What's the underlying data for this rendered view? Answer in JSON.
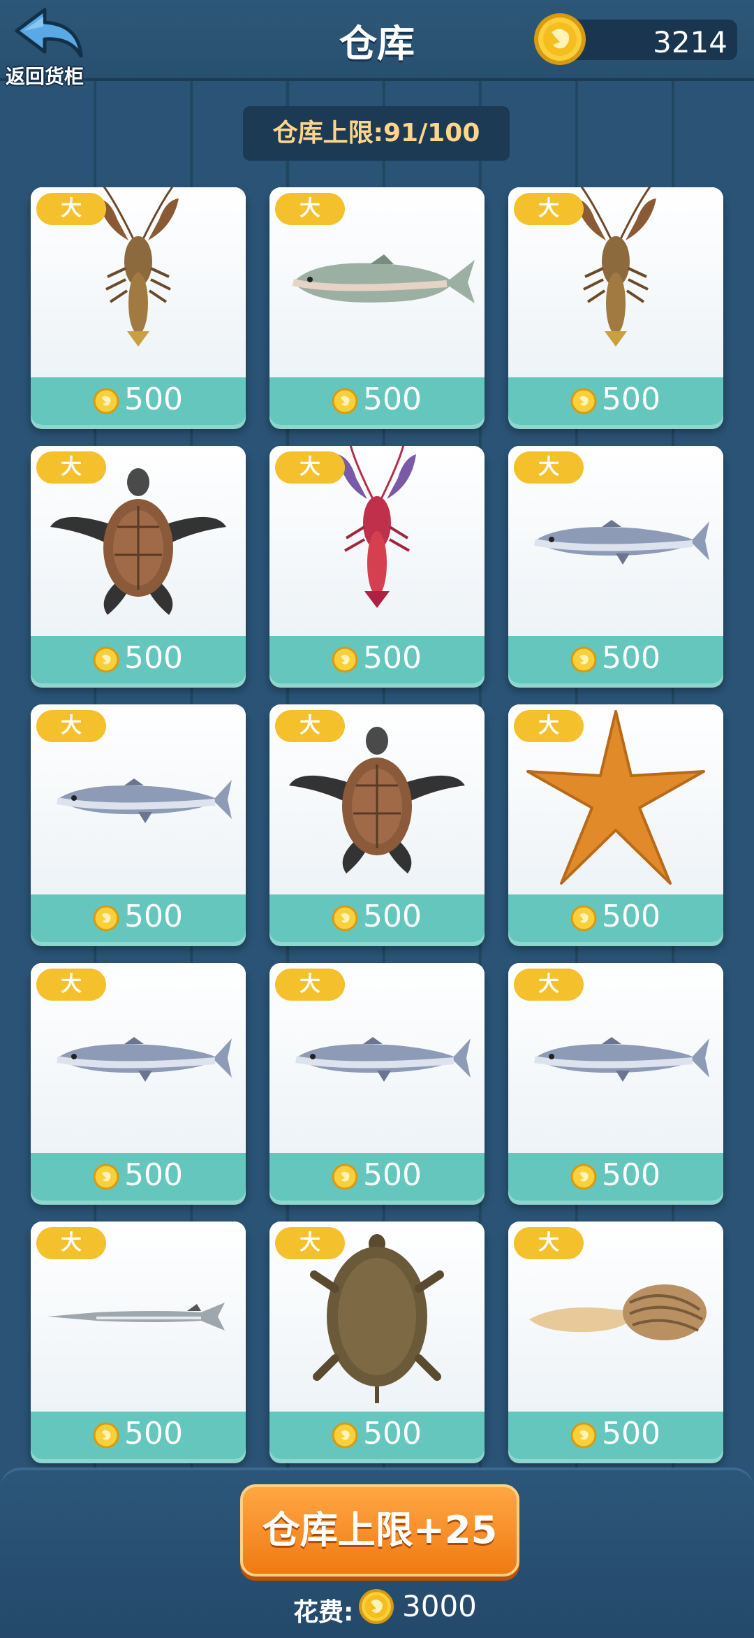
{
  "header": {
    "back_label": "返回货柜",
    "title": "仓库",
    "coins": "3214"
  },
  "capacity": {
    "text": "仓库上限:91/100"
  },
  "items": [
    {
      "size": "大",
      "price": "500",
      "animal": "crayfish"
    },
    {
      "size": "大",
      "price": "500",
      "animal": "salmon"
    },
    {
      "size": "大",
      "price": "500",
      "animal": "crayfish"
    },
    {
      "size": "大",
      "price": "500",
      "animal": "sea-turtle"
    },
    {
      "size": "大",
      "price": "500",
      "animal": "red-lobster"
    },
    {
      "size": "大",
      "price": "500",
      "animal": "mackerel"
    },
    {
      "size": "大",
      "price": "500",
      "animal": "mackerel"
    },
    {
      "size": "大",
      "price": "500",
      "animal": "sea-turtle"
    },
    {
      "size": "大",
      "price": "500",
      "animal": "starfish"
    },
    {
      "size": "大",
      "price": "500",
      "animal": "mackerel"
    },
    {
      "size": "大",
      "price": "500",
      "animal": "mackerel"
    },
    {
      "size": "大",
      "price": "500",
      "animal": "mackerel"
    },
    {
      "size": "大",
      "price": "500",
      "animal": "needlefish"
    },
    {
      "size": "大",
      "price": "500",
      "animal": "softshell-turtle"
    },
    {
      "size": "大",
      "price": "500",
      "animal": "clam"
    }
  ],
  "footer": {
    "expand_label": "仓库上限+25",
    "cost_label": "花费:",
    "cost_value": "3000"
  },
  "colors": {
    "accent_orange": "#f58a1f",
    "badge_yellow": "#f4c12c",
    "price_teal": "#64c6bd",
    "background_blue": "#264d6d"
  }
}
